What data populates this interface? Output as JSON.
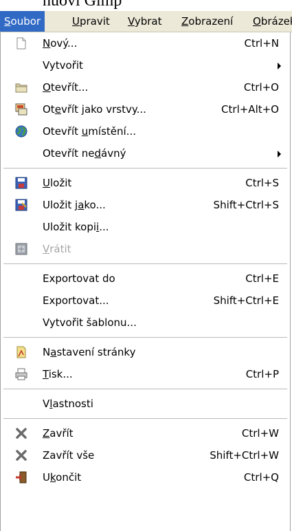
{
  "caption": "nuovi Gimp",
  "menubar": [
    {
      "label": "Soubor",
      "ul": "S",
      "active": true
    },
    {
      "label": "Upravit",
      "ul": "U"
    },
    {
      "label": "Vybrat",
      "ul": "V"
    },
    {
      "label": "Zobrazení",
      "ul": "Z"
    },
    {
      "label": "Obrázek",
      "ul": "O"
    }
  ],
  "menu": [
    {
      "label": "Nový...",
      "ul": "N",
      "shortcut": "Ctrl+N",
      "icon": "new-file-icon"
    },
    {
      "label": "Vytvořit",
      "submenu": true
    },
    {
      "label": "Otevřít...",
      "ul": "O",
      "shortcut": "Ctrl+O",
      "icon": "open-folder-icon"
    },
    {
      "label": "Otevřít jako vrstvy...",
      "ul": "e",
      "ulIndex": 2,
      "shortcut": "Ctrl+Alt+O",
      "icon": "open-as-layers-icon"
    },
    {
      "label": "Otevřít umístění...",
      "ul": "u",
      "ulIndex": 8,
      "icon": "globe-icon"
    },
    {
      "label": "Otevřít nedávný",
      "ul": "d",
      "ulIndex": 10,
      "submenu": true
    },
    {
      "separator": true
    },
    {
      "label": "Uložit",
      "ul": "U",
      "shortcut": "Ctrl+S",
      "icon": "save-icon"
    },
    {
      "label": "Uložit jako...",
      "ul": "a",
      "ulIndex": 8,
      "shortcut": "Shift+Ctrl+S",
      "icon": "save-as-icon"
    },
    {
      "label": "Uložit kopii...",
      "ul": "i",
      "ulIndex": 11
    },
    {
      "label": "Vrátit",
      "ul": "V",
      "disabled": true,
      "icon": "revert-icon"
    },
    {
      "separator": true
    },
    {
      "label": "Exportovat do",
      "shortcut": "Ctrl+E"
    },
    {
      "label": "Exportovat...",
      "shortcut": "Shift+Ctrl+E"
    },
    {
      "label": "Vytvořit šablonu..."
    },
    {
      "separator": true
    },
    {
      "label": "Nastavení stránky",
      "ul": "a",
      "ulIndex": 1,
      "icon": "page-setup-icon"
    },
    {
      "label": "Tisk...",
      "ul": "T",
      "shortcut": "Ctrl+P",
      "icon": "print-icon"
    },
    {
      "separator": true
    },
    {
      "label": "Vlastnosti",
      "ul": "l",
      "ulIndex": 1
    },
    {
      "separator": true
    },
    {
      "label": "Zavřít",
      "ul": "Z",
      "shortcut": "Ctrl+W",
      "icon": "close-icon"
    },
    {
      "label": "Zavřít vše",
      "shortcut": "Shift+Ctrl+W",
      "icon": "close-all-icon"
    },
    {
      "label": "Ukončit",
      "ul": "k",
      "ulIndex": 1,
      "shortcut": "Ctrl+Q",
      "icon": "quit-icon"
    }
  ],
  "colors": {
    "menu_highlight": "#316ac5",
    "menubar_bg": "#ece9d8",
    "disabled_text": "#a5a5a5"
  }
}
